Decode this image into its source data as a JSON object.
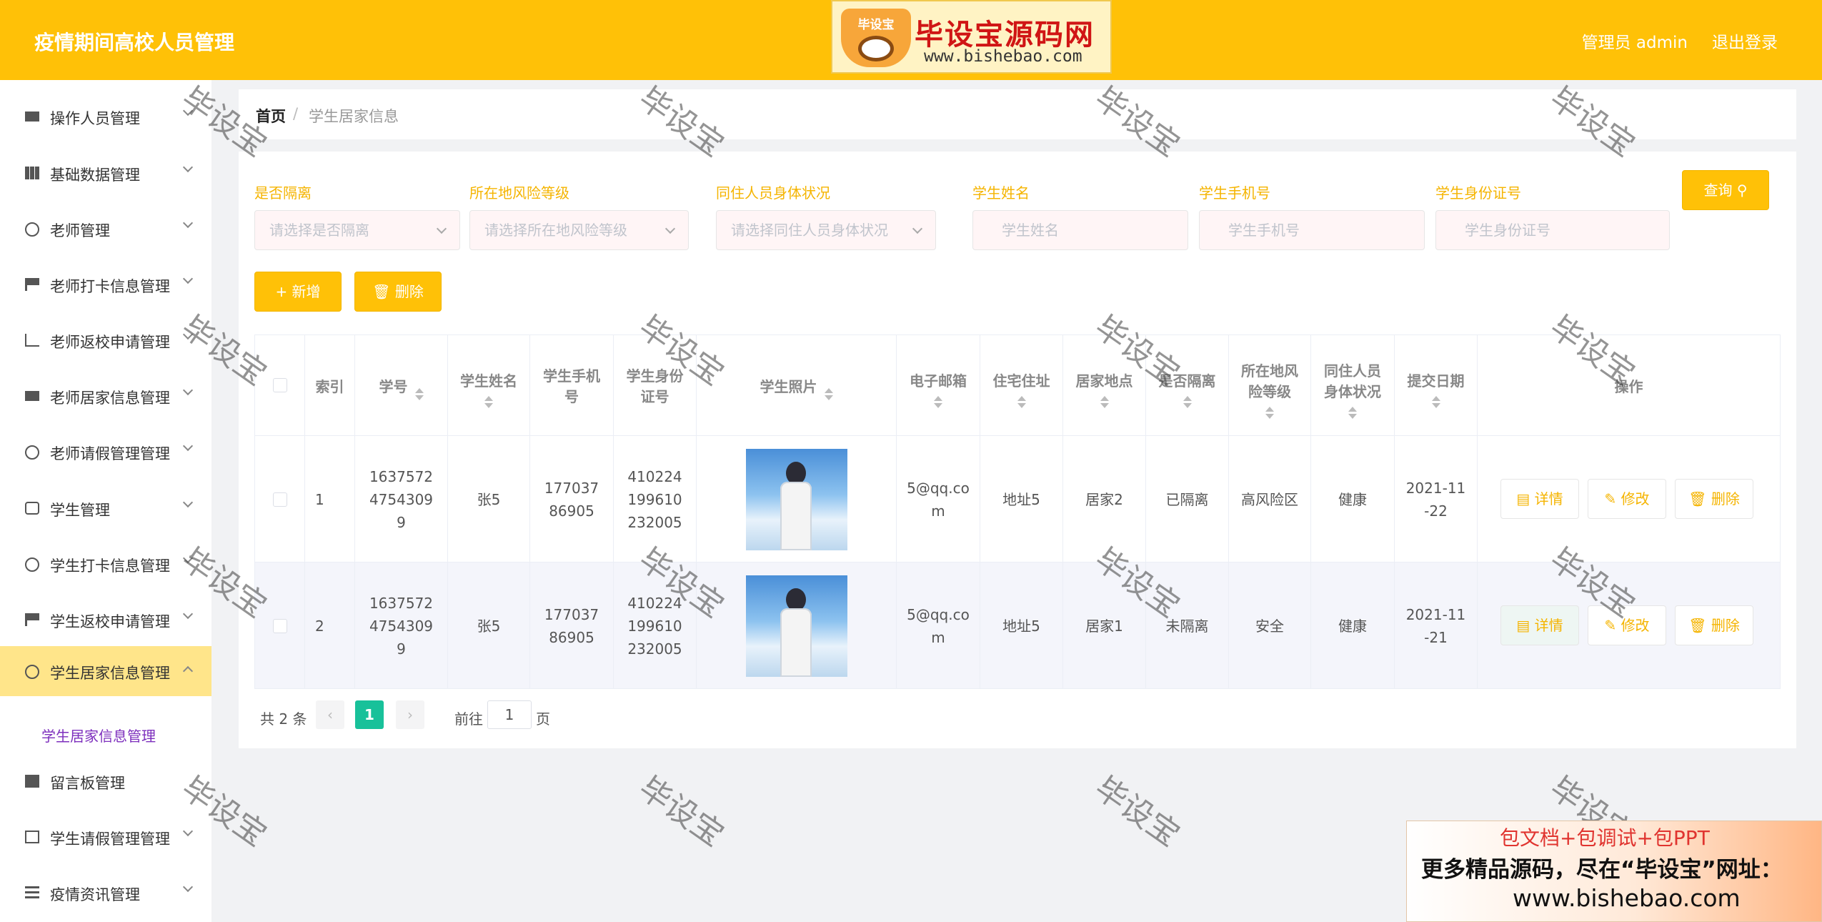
{
  "header": {
    "title": "疫情期间高校人员管理",
    "user": "管理员 admin",
    "logout": "退出登录",
    "logo_badge": "毕设宝",
    "logo_brand": "毕设宝源码网",
    "logo_url": "www.bishebao.com"
  },
  "sidebar": {
    "items": [
      {
        "label": "操作人员管理",
        "icon": "user-bar-icon"
      },
      {
        "label": "基础数据管理",
        "icon": "grid-icon"
      },
      {
        "label": "老师管理",
        "icon": "compass-icon"
      },
      {
        "label": "老师打卡信息管理",
        "icon": "stamp-icon"
      },
      {
        "label": "老师返校申请管理",
        "icon": "chart-icon"
      },
      {
        "label": "老师居家信息管理",
        "icon": "camera-icon"
      },
      {
        "label": "老师请假管理管理",
        "icon": "power-icon"
      },
      {
        "label": "学生管理",
        "icon": "chat-icon"
      },
      {
        "label": "学生打卡信息管理",
        "icon": "gauge-icon"
      },
      {
        "label": "学生返校申请管理",
        "icon": "flag-icon"
      },
      {
        "label": "学生居家信息管理",
        "icon": "bell-off-icon"
      },
      {
        "label": "留言板管理",
        "icon": "printer-icon"
      },
      {
        "label": "学生请假管理管理",
        "icon": "crop-icon"
      },
      {
        "label": "疫情资讯管理",
        "icon": "list-icon"
      }
    ],
    "submenu_label": "学生居家信息管理"
  },
  "breadcrumb": {
    "home": "首页",
    "separator": "/",
    "current": "学生居家信息"
  },
  "filters": {
    "isolated": {
      "label": "是否隔离",
      "placeholder": "请选择是否隔离"
    },
    "risk": {
      "label": "所在地风险等级",
      "placeholder": "请选择所在地风险等级"
    },
    "cohabitant": {
      "label": "同住人员身体状况",
      "placeholder": "请选择同住人员身体状况"
    },
    "name": {
      "label": "学生姓名",
      "placeholder": "学生姓名"
    },
    "phone": {
      "label": "学生手机号",
      "placeholder": "学生手机号"
    },
    "idcard": {
      "label": "学生身份证号",
      "placeholder": "学生身份证号"
    },
    "query_label": "查询"
  },
  "actions": {
    "add_label": "+ 新增",
    "delete_label": "删除"
  },
  "table": {
    "headers": {
      "index": "索引",
      "student_no": "学号",
      "name": "学生姓名",
      "phone": "学生手机号",
      "idcard": "学生身份证号",
      "photo": "学生照片",
      "email": "电子邮箱",
      "address": "住宅住址",
      "location": "居家地点",
      "isolated": "是否隔离",
      "risk": "所在地风险等级",
      "cohabitant": "同住人员身体状况",
      "date": "提交日期",
      "ops": "操作"
    },
    "rows": [
      {
        "index": "1",
        "student_no": "163757247543099",
        "name": "张5",
        "phone": "17703786905",
        "idcard": "410224199610232005",
        "email": "5@qq.com",
        "address": "地址5",
        "location": "居家2",
        "isolated": "已隔离",
        "risk": "高风险区",
        "cohabitant": "健康",
        "date": "2021-11-22"
      },
      {
        "index": "2",
        "student_no": "163757247543099",
        "name": "张5",
        "phone": "17703786905",
        "idcard": "410224199610232005",
        "email": "5@qq.com",
        "address": "地址5",
        "location": "居家1",
        "isolated": "未隔离",
        "risk": "安全",
        "cohabitant": "健康",
        "date": "2021-11-21"
      }
    ],
    "op_labels": {
      "detail": "详情",
      "edit": "修改",
      "delete": "删除"
    }
  },
  "pagination": {
    "total": "共 2 条",
    "current": "1",
    "goto": "前往",
    "page_value": "1",
    "page_suffix": "页"
  },
  "watermark": "毕设宝",
  "ad": {
    "line1": "包文档+包调试+包PPT",
    "line2": "更多精品源码，尽在“毕设宝”网址：",
    "line3": "www.bishebao.com"
  },
  "colors": {
    "accent": "#ffc107",
    "active_menu": "#ffe58a",
    "page_current": "#18c19a",
    "label": "#f5b400"
  }
}
